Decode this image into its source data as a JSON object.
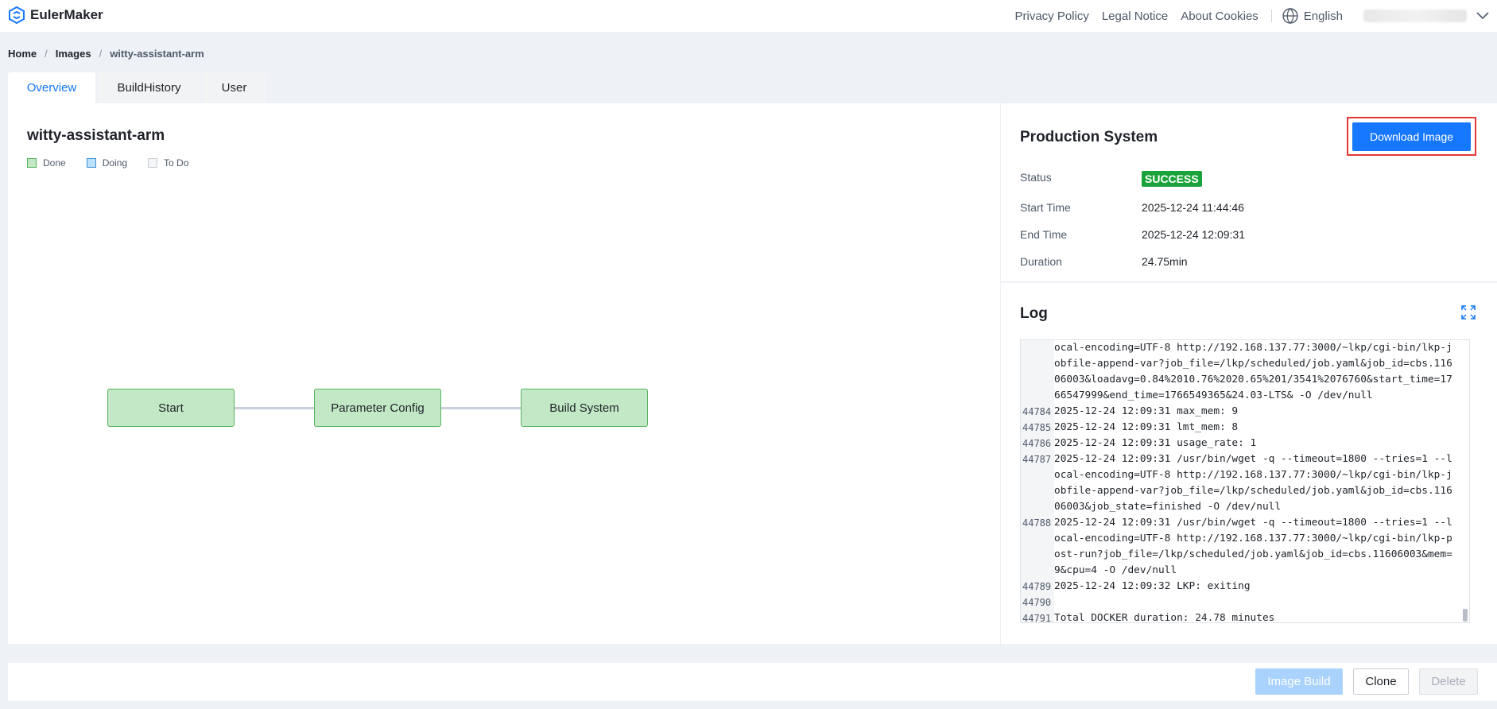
{
  "header": {
    "brand": "EulerMaker",
    "links": [
      "Privacy Policy",
      "Legal Notice",
      "About Cookies"
    ],
    "language": "English"
  },
  "breadcrumb": [
    "Home",
    "Images",
    "witty-assistant-arm"
  ],
  "tabs": [
    {
      "label": "Overview",
      "active": true
    },
    {
      "label": "BuildHistory",
      "active": false
    },
    {
      "label": "User",
      "active": false
    }
  ],
  "pipeline": {
    "title": "witty-assistant-arm",
    "legend": {
      "done": "Done",
      "doing": "Doing",
      "todo": "To Do"
    },
    "nodes": [
      "Start",
      "Parameter Config",
      "Build System"
    ]
  },
  "production": {
    "title": "Production System",
    "download_label": "Download Image",
    "status_label": "Status",
    "status_value": "SUCCESS",
    "start_label": "Start Time",
    "start_value": "2025-12-24 11:44:46",
    "end_label": "End Time",
    "end_value": "2025-12-24 12:09:31",
    "duration_label": "Duration",
    "duration_value": "24.75min"
  },
  "log": {
    "title": "Log",
    "lines": [
      {
        "n": "",
        "t": "ocal-encoding=UTF-8 http://192.168.137.77:3000/~lkp/cgi-bin/lkp-j"
      },
      {
        "n": "",
        "t": "obfile-append-var?job_file=/lkp/scheduled/job.yaml&job_id=cbs.116"
      },
      {
        "n": "",
        "t": "06003&loadavg=0.84%2010.76%2020.65%201/3541%2076760&start_time=17"
      },
      {
        "n": "",
        "t": "66547999&end_time=1766549365&24.03-LTS& -O /dev/null"
      },
      {
        "n": "44784",
        "t": "2025-12-24 12:09:31 max_mem: 9"
      },
      {
        "n": "44785",
        "t": "2025-12-24 12:09:31 lmt_mem: 8"
      },
      {
        "n": "44786",
        "t": "2025-12-24 12:09:31 usage_rate: 1"
      },
      {
        "n": "44787",
        "t": "2025-12-24 12:09:31 /usr/bin/wget -q --timeout=1800 --tries=1 --l"
      },
      {
        "n": "",
        "t": "ocal-encoding=UTF-8 http://192.168.137.77:3000/~lkp/cgi-bin/lkp-j"
      },
      {
        "n": "",
        "t": "obfile-append-var?job_file=/lkp/scheduled/job.yaml&job_id=cbs.116"
      },
      {
        "n": "",
        "t": "06003&job_state=finished -O /dev/null"
      },
      {
        "n": "44788",
        "t": "2025-12-24 12:09:31 /usr/bin/wget -q --timeout=1800 --tries=1 --l"
      },
      {
        "n": "",
        "t": "ocal-encoding=UTF-8 http://192.168.137.77:3000/~lkp/cgi-bin/lkp-p"
      },
      {
        "n": "",
        "t": "ost-run?job_file=/lkp/scheduled/job.yaml&job_id=cbs.11606003&mem="
      },
      {
        "n": "",
        "t": "9&cpu=4 -O /dev/null"
      },
      {
        "n": "44789",
        "t": "2025-12-24 12:09:32 LKP: exiting"
      },
      {
        "n": "44790",
        "t": ""
      },
      {
        "n": "44791",
        "t": "Total DOCKER duration: 24.78 minutes"
      }
    ]
  },
  "footer": {
    "image_build": "Image Build",
    "clone": "Clone",
    "delete": "Delete"
  },
  "colors": {
    "primary": "#1677ff",
    "success": "#1aa33a",
    "done_fill": "#c3e8c6",
    "highlight": "#e53935"
  }
}
